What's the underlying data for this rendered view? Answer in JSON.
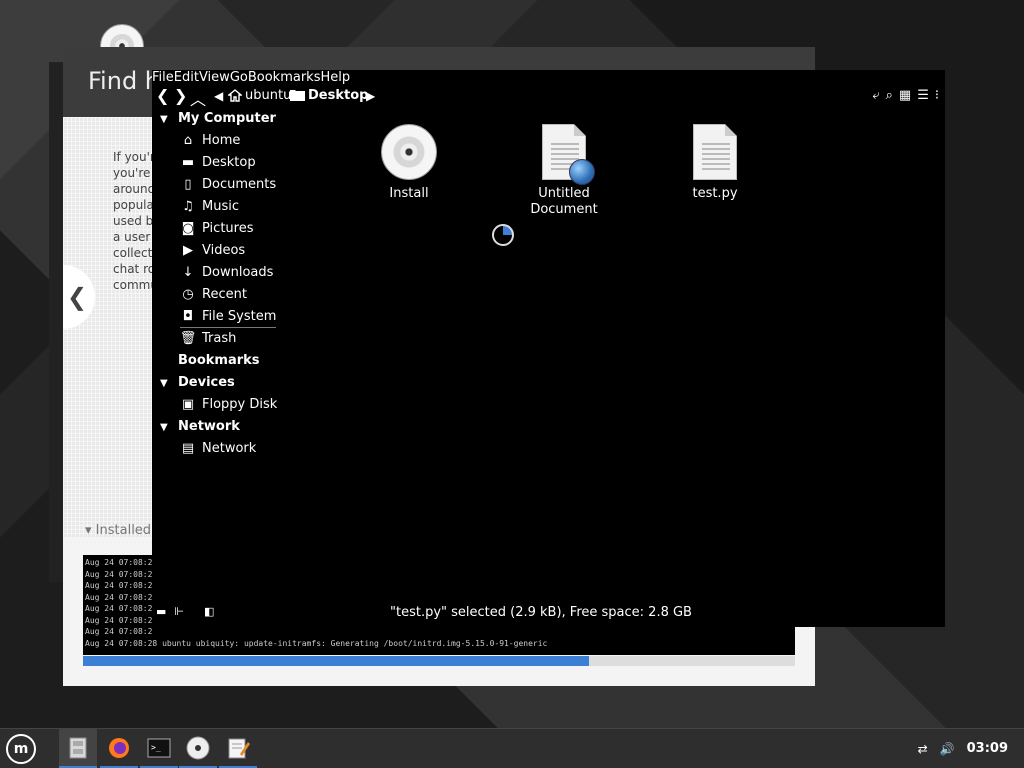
{
  "installer": {
    "title": "Find h",
    "text_lines": [
      "If you'r",
      "you're l",
      "around",
      "popular",
      "used by",
      "a user g",
      "collecti",
      "chat ro",
      "commu"
    ],
    "installed_label": "Installed",
    "log_lines": [
      "Aug 24 07:08:2",
      "Aug 24 07:08:2",
      "Aug 24 07:08:2",
      "Aug 24 07:08:2",
      "Aug 24 07:08:2",
      "Aug 24 07:08:2",
      "Aug 24 07:08:2",
      "Aug 24 07:08:28 ubuntu ubiquity: update-initramfs: Generating /boot/initrd.img-5.15.0-91-generic"
    ],
    "progress_fraction": 0.71
  },
  "file_manager": {
    "menu": [
      "File",
      "Edit",
      "View",
      "Go",
      "Bookmarks",
      "Help"
    ],
    "breadcrumb": [
      "ubuntu",
      "Desktop"
    ],
    "sidebar": {
      "my_computer": "My Computer",
      "items": [
        "Home",
        "Desktop",
        "Documents",
        "Music",
        "Pictures",
        "Videos",
        "Downloads",
        "Recent",
        "File System",
        "Trash"
      ],
      "bookmarks": "Bookmarks",
      "devices": "Devices",
      "device_items": [
        "Floppy Disk"
      ],
      "network": "Network",
      "network_items": [
        "Network"
      ]
    },
    "files": [
      {
        "name": "Install",
        "icon": "disc-icon"
      },
      {
        "name": "Untitled Document",
        "icon": "document-globe-icon"
      },
      {
        "name": "test.py",
        "icon": "text-file-icon"
      }
    ],
    "status": "\"test.py\" selected (2.9 kB), Free space: 2.8 GB"
  },
  "taskbar": {
    "clock": "03:09",
    "accent": "#3d7fd4"
  }
}
